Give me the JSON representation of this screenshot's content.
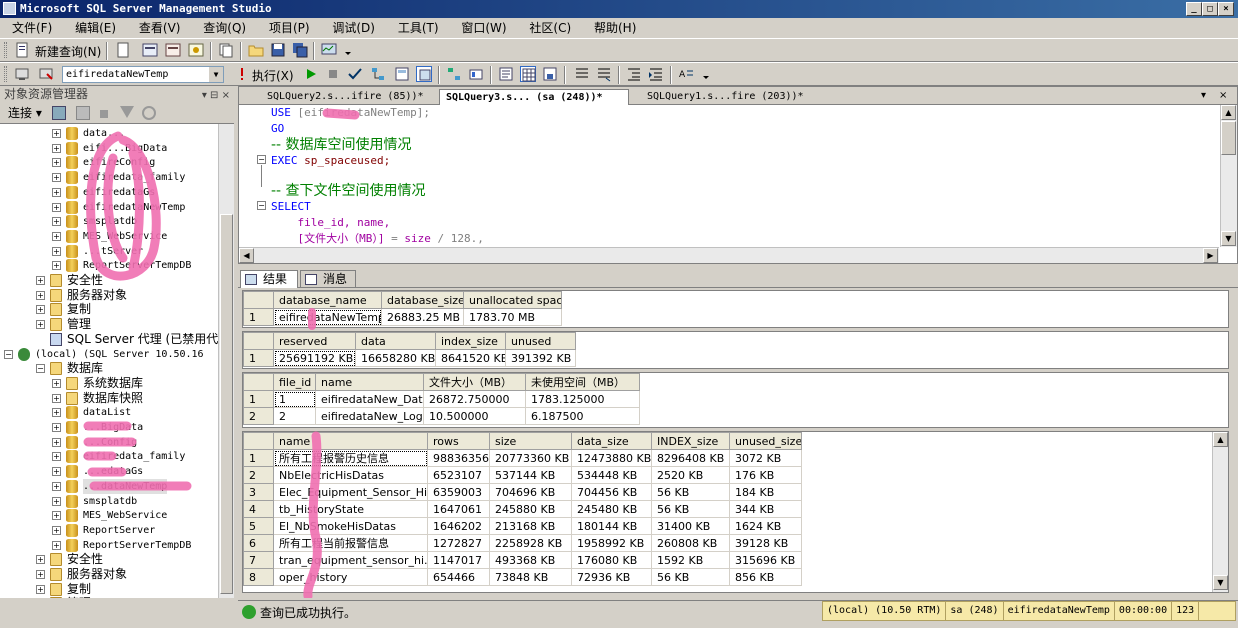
{
  "window": {
    "title": "Microsoft SQL Server Management Studio"
  },
  "menu": [
    "文件(F)",
    "编辑(E)",
    "查看(V)",
    "查询(Q)",
    "项目(P)",
    "调试(D)",
    "工具(T)",
    "窗口(W)",
    "社区(C)",
    "帮助(H)"
  ],
  "toolbar1": {
    "new_query": "新建查询(N)"
  },
  "toolbar2": {
    "database": "eifiredataNewTemp",
    "execute": "执行(X)"
  },
  "object_explorer": {
    "title": "对象资源管理器",
    "connect": "连接",
    "tree1": [
      {
        "label": "data...",
        "type": "db"
      },
      {
        "label": "eifi...BigData",
        "type": "db"
      },
      {
        "label": "eifireConfig",
        "type": "db"
      },
      {
        "label": "eifiredata_family",
        "type": "db"
      },
      {
        "label": "eifiredataGs",
        "type": "db"
      },
      {
        "label": "eifiredataNewTemp",
        "type": "db"
      },
      {
        "label": "smsplatdb",
        "type": "db"
      },
      {
        "label": "MES_WebService",
        "type": "db"
      },
      {
        "label": "...tServer",
        "type": "db"
      },
      {
        "label": "ReportServerTempDB",
        "type": "db"
      }
    ],
    "folders1": [
      "安全性",
      "服务器对象",
      "复制",
      "管理"
    ],
    "agent": "SQL Server 代理 (已禁用代理",
    "server": "(local) (SQL Server 10.50.16",
    "databases_label": "数据库",
    "sysfolders": [
      "系统数据库",
      "数据库快照"
    ],
    "tree2": [
      "dataList",
      "...BigData",
      "...Config",
      "eifiredata_family",
      "...edataGs",
      "...dataNewTemp",
      "smsplatdb",
      "MES_WebService",
      "ReportServer",
      "ReportServerTempDB"
    ],
    "folders2": [
      "安全性",
      "服务器对象",
      "复制",
      "管理"
    ]
  },
  "editor": {
    "tabs": [
      {
        "label": "SQLQuery2.s...ifire (85))*"
      },
      {
        "label": "SQLQuery3.s...  (sa (248))*"
      },
      {
        "label": "SQLQuery1.s...fire (203))*"
      }
    ],
    "lines": {
      "l1_kw": "USE",
      "l1_rest": " [eifiredataNewTemp];",
      "l2": "GO",
      "l3": "-- 数据库空间使用情况",
      "l4_kw": "EXEC",
      "l4_rest": " sp_spaceused;",
      "l5": "-- 查下文件空间使用情况",
      "l6": "SELECT",
      "l7": "    file_id, name,",
      "l8a": "    [文件大小（MB）]",
      "l8b": " = ",
      "l8c": "size",
      "l8d": " / 128.,"
    }
  },
  "results": {
    "tab_results": "结果",
    "tab_messages": "消息",
    "grid1": {
      "columns": [
        "database_name",
        "database_size",
        "unallocated space"
      ],
      "rows": [
        [
          "1",
          "eifiredataNewTemp",
          "26883.25 MB",
          "1783.70 MB"
        ]
      ]
    },
    "grid2": {
      "columns": [
        "reserved",
        "data",
        "index_size",
        "unused"
      ],
      "rows": [
        [
          "1",
          "25691192 KB",
          "16658280 KB",
          "8641520 KB",
          "391392 KB"
        ]
      ]
    },
    "grid3": {
      "columns": [
        "file_id",
        "name",
        "文件大小（MB）",
        "未使用空间（MB）"
      ],
      "rows": [
        [
          "1",
          "1",
          "eifiredataNew_Data",
          "26872.750000",
          "1783.125000"
        ],
        [
          "2",
          "2",
          "eifiredataNew_Log",
          "10.500000",
          "6.187500"
        ]
      ]
    },
    "grid4": {
      "columns": [
        "name",
        "rows",
        "size",
        "data_size",
        "INDEX_size",
        "unused_size"
      ],
      "rows": [
        [
          "1",
          "所有工程报警历史信息",
          "98836356",
          "20773360 KB",
          "12473880 KB",
          "8296408 KB",
          "3072 KB"
        ],
        [
          "2",
          "NbElectricHisDatas",
          "6523107",
          "537144 KB",
          "534448 KB",
          "2520 KB",
          "176 KB"
        ],
        [
          "3",
          "Elec_Equipment_Sensor_His",
          "6359003",
          "704696 KB",
          "704456 KB",
          "56 KB",
          "184 KB"
        ],
        [
          "4",
          "tb_HistoryState",
          "1647061",
          "245880 KB",
          "245480 KB",
          "56 KB",
          "344 KB"
        ],
        [
          "5",
          "El_NbSmokeHisDatas",
          "1646202",
          "213168 KB",
          "180144 KB",
          "31400 KB",
          "1624 KB"
        ],
        [
          "6",
          "所有工程当前报警信息",
          "1272827",
          "2258928 KB",
          "1958992 KB",
          "260808 KB",
          "39128 KB"
        ],
        [
          "7",
          "tran_equipment_sensor_hi...",
          "1147017",
          "493368 KB",
          "176080 KB",
          "1592 KB",
          "315696 KB"
        ],
        [
          "8",
          "oper_history",
          "654466",
          "73848 KB",
          "72936 KB",
          "56 KB",
          "856 KB"
        ]
      ]
    }
  },
  "status": {
    "message": "查询已成功执行。",
    "server": "(local) (10.50 RTM)",
    "user": "sa (248)",
    "db": "eifiredataNewTemp",
    "time": "00:00:00",
    "rows": "123"
  }
}
